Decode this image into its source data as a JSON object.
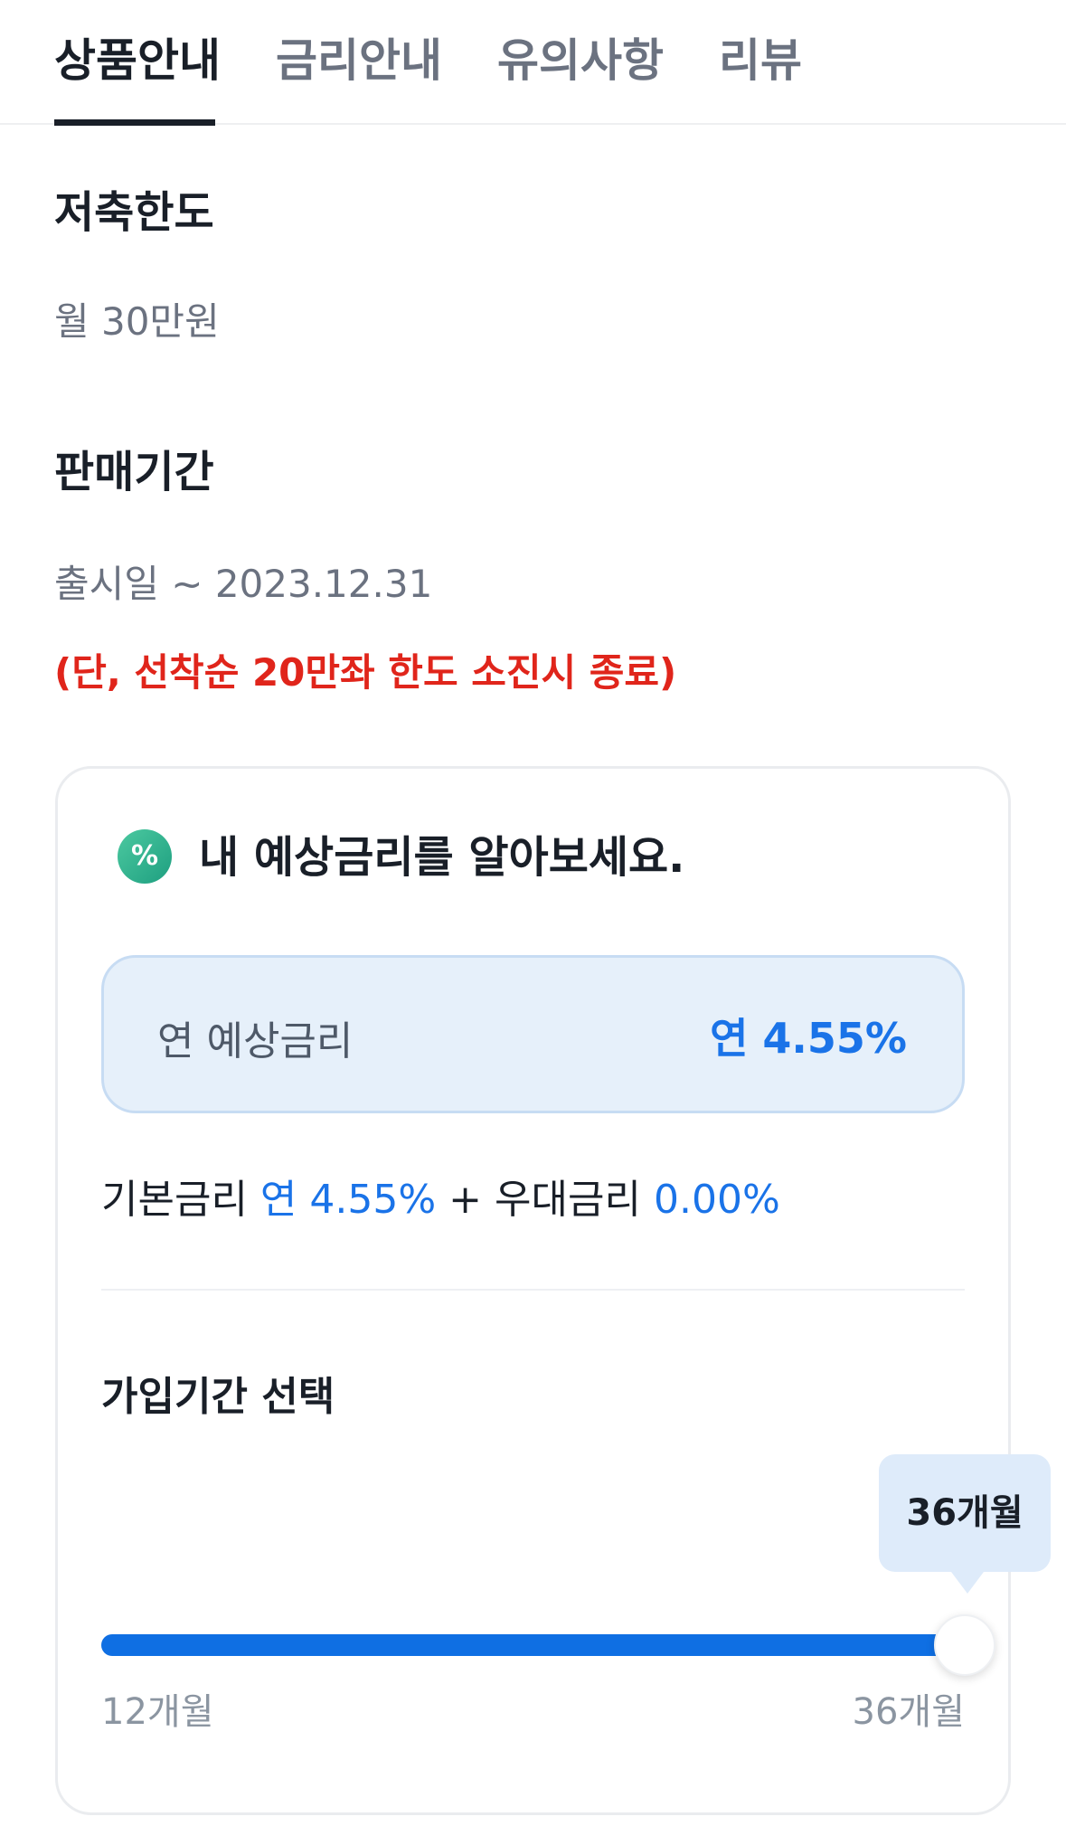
{
  "tabs": [
    {
      "label": "상품안내",
      "active": true
    },
    {
      "label": "금리안내",
      "active": false
    },
    {
      "label": "유의사항",
      "active": false
    },
    {
      "label": "리뷰",
      "active": false
    }
  ],
  "limit": {
    "title": "저축한도",
    "value": "월 30만원"
  },
  "sale_period": {
    "title": "판매기간",
    "value": "출시일 ~ 2023.12.31",
    "notice": "(단, 선착순 20만좌 한도 소진시 종료)"
  },
  "rate_card": {
    "icon": "percent-icon",
    "title": "내 예상금리를 알아보세요.",
    "expected_label": "연 예상금리",
    "expected_value": "연 4.55%",
    "base_label": "기본금리",
    "base_value": "연 4.55%",
    "plus": "+",
    "bonus_label": "우대금리",
    "bonus_value": "0.00%"
  },
  "term": {
    "title": "가입기간 선택",
    "selected_label": "36개월",
    "min_label": "12개월",
    "max_label": "36개월",
    "min": 12,
    "max": 36,
    "value": 36
  },
  "colors": {
    "accent": "#0f6fe3",
    "notice": "#e0251b",
    "rate_box_bg": "#e6f0fa"
  }
}
